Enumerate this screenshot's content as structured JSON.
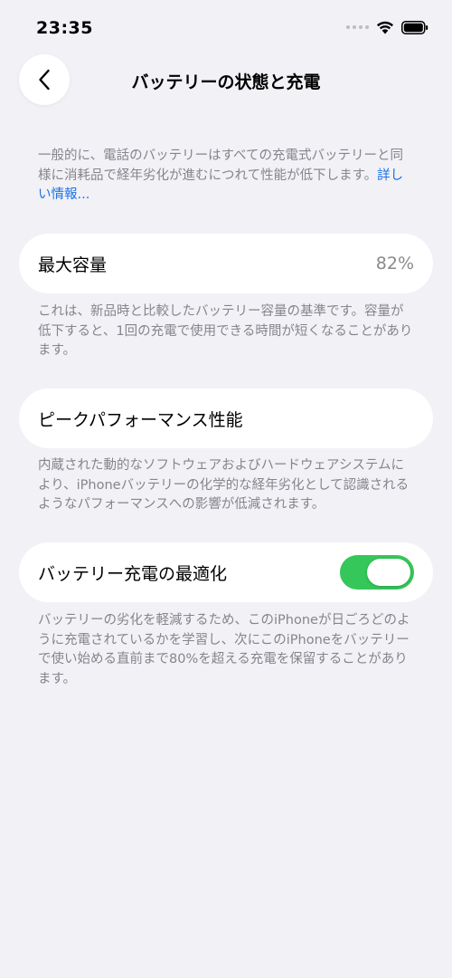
{
  "status_bar": {
    "time": "23:35"
  },
  "nav": {
    "title": "バッテリーの状態と充電"
  },
  "intro": {
    "text": "一般的に、電話のバッテリーはすべての充電式バッテリーと同様に消耗品で経年劣化が進むにつれて性能が低下します。",
    "link": "詳しい情報..."
  },
  "max_capacity": {
    "label": "最大容量",
    "value": "82%",
    "value_percent": 82,
    "description": "これは、新品時と比較したバッテリー容量の基準です。容量が低下すると、1回の充電で使用できる時間が短くなることがあります。"
  },
  "peak_performance": {
    "label": "ピークパフォーマンス性能",
    "description": "内蔵された動的なソフトウェアおよびハードウェアシステムにより、iPhoneバッテリーの化学的な経年劣化として認識されるようなパフォーマンスへの影響が低減されます。"
  },
  "optimized_charging": {
    "label": "バッテリー充電の最適化",
    "enabled": true,
    "description": "バッテリーの劣化を軽減するため、このiPhoneが日ごろどのように充電されているかを学習し、次にこのiPhoneをバッテリーで使い始める直前まで80%を超える充電を保留することがあります。"
  },
  "colors": {
    "background": "#f2f1f6",
    "card": "#ffffff",
    "toggle_on": "#35c759",
    "link": "#1a73e8",
    "secondary_text": "#85858b"
  },
  "icons": {
    "back": "chevron-left-icon",
    "wifi": "wifi-icon",
    "battery": "battery-icon",
    "signal": "cellular-signal-icon"
  }
}
